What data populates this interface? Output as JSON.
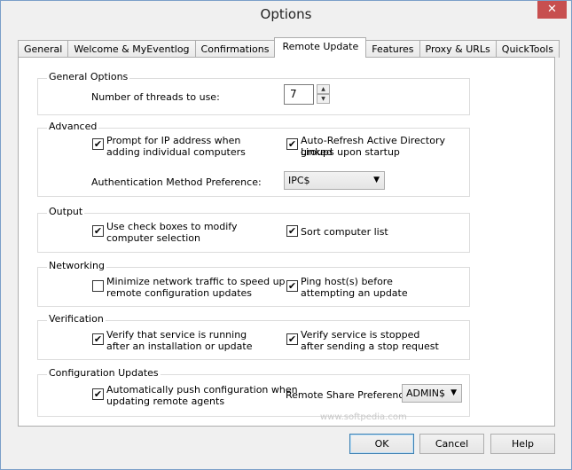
{
  "window": {
    "title": "Options",
    "close_symbol": "✕"
  },
  "tabs": [
    {
      "label": "General"
    },
    {
      "label": "Welcome & MyEventlog"
    },
    {
      "label": "Confirmations"
    },
    {
      "label": "Remote Update"
    },
    {
      "label": "Features"
    },
    {
      "label": "Proxy & URLs"
    },
    {
      "label": "QuickTools"
    }
  ],
  "active_tab": "Remote Update",
  "general_options": {
    "title": "General Options",
    "threads_label": "Number of threads to use:",
    "threads_value": "7"
  },
  "advanced": {
    "title": "Advanced",
    "prompt_ip": {
      "label_line1": "Prompt for IP address when",
      "label_line2": "adding individual computers",
      "checked": true
    },
    "auto_refresh": {
      "label_line1": "Auto-Refresh Active Directory Linked",
      "label_line2": "groups upon startup",
      "checked": true
    },
    "auth_label": "Authentication Method Preference:",
    "auth_value": "IPC$"
  },
  "output": {
    "title": "Output",
    "use_checkboxes": {
      "label_line1": "Use check boxes to modify",
      "label_line2": "computer selection",
      "checked": true
    },
    "sort_list": {
      "label": "Sort computer list",
      "checked": true
    }
  },
  "networking": {
    "title": "Networking",
    "minimize_traffic": {
      "label_line1": "Minimize network traffic to speed up",
      "label_line2": "remote configuration updates",
      "checked": false
    },
    "ping_hosts": {
      "label_line1": "Ping host(s) before",
      "label_line2": "attempting an update",
      "checked": true
    }
  },
  "verification": {
    "title": "Verification",
    "verify_running": {
      "label_line1": "Verify that service is running",
      "label_line2": "after an installation or update",
      "checked": true
    },
    "verify_stopped": {
      "label_line1": "Verify service is stopped",
      "label_line2": "after sending a stop request",
      "checked": true
    }
  },
  "config_updates": {
    "title": "Configuration Updates",
    "auto_push": {
      "label_line1": "Automatically push configuration when",
      "label_line2": "updating remote agents",
      "checked": true
    },
    "share_label": "Remote Share Preference:",
    "share_value": "ADMIN$"
  },
  "buttons": {
    "ok": "OK",
    "cancel": "Cancel",
    "help": "Help"
  },
  "watermark": "www.softpedia.com",
  "check_mark": "✔"
}
